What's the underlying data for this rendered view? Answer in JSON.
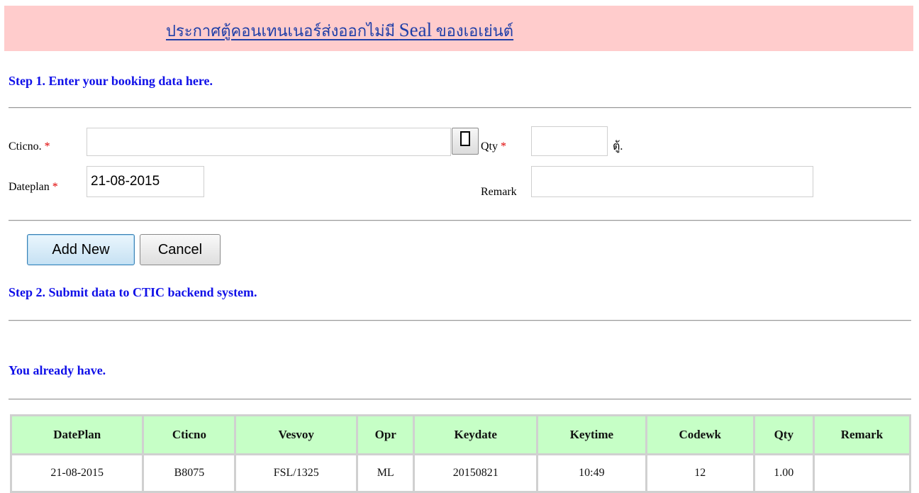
{
  "banner": {
    "title_before": "ประกาศตู้คอนเทนเนอร์ส่งออกไม่มี ",
    "title_seal": "Seal",
    "title_after": " ของเอเย่นต์"
  },
  "step1": {
    "heading": "Step 1. Enter your booking data here."
  },
  "form": {
    "cticno": {
      "label": "Cticno.",
      "required_mark": "*",
      "value": ""
    },
    "qty": {
      "label": "Qty",
      "required_mark": "*",
      "value": "",
      "unit": "ตู้."
    },
    "dateplan": {
      "label": "Dateplan",
      "required_mark": "*",
      "value": "21-08-2015"
    },
    "remark": {
      "label": "Remark",
      "value": ""
    }
  },
  "buttons": {
    "add_new": "Add New",
    "cancel": "Cancel"
  },
  "step2": {
    "heading": "Step 2. Submit data to CTIC backend system."
  },
  "existing": {
    "heading": "You already have."
  },
  "table": {
    "columns": [
      "DatePlan",
      "Cticno",
      "Vesvoy",
      "Opr",
      "Keydate",
      "Keytime",
      "Codewk",
      "Qty",
      "Remark"
    ],
    "rows": [
      [
        "21-08-2015",
        "B8075",
        "FSL/1325",
        "ML",
        "20150821",
        "10:49",
        "12",
        "1.00",
        ""
      ]
    ]
  },
  "colors": {
    "banner_bg": "#ffcccc",
    "heading": "#1010e8",
    "required": "#e00000",
    "table_header_bg": "#c6ffc6"
  }
}
